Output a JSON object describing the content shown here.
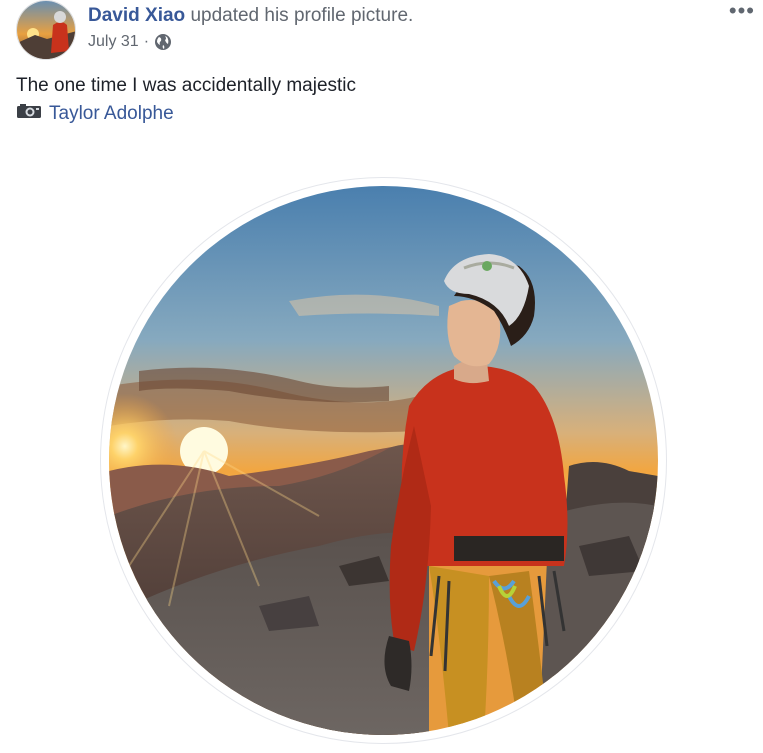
{
  "post": {
    "author": "David Xiao",
    "action": "updated his profile picture.",
    "date": "July 31",
    "date_separator": "·",
    "privacy_icon": "globe-icon",
    "more_label": "•••",
    "caption": "The one time I was accidentally majestic",
    "credit_icon": "camera-icon",
    "credit_name": "Taylor Adolphe"
  },
  "colors": {
    "link": "#385898",
    "text": "#1d2129",
    "meta": "#616770",
    "jacket": "#c8321c",
    "sky_top": "#5a8fb8",
    "sunset": "#f0a030"
  }
}
